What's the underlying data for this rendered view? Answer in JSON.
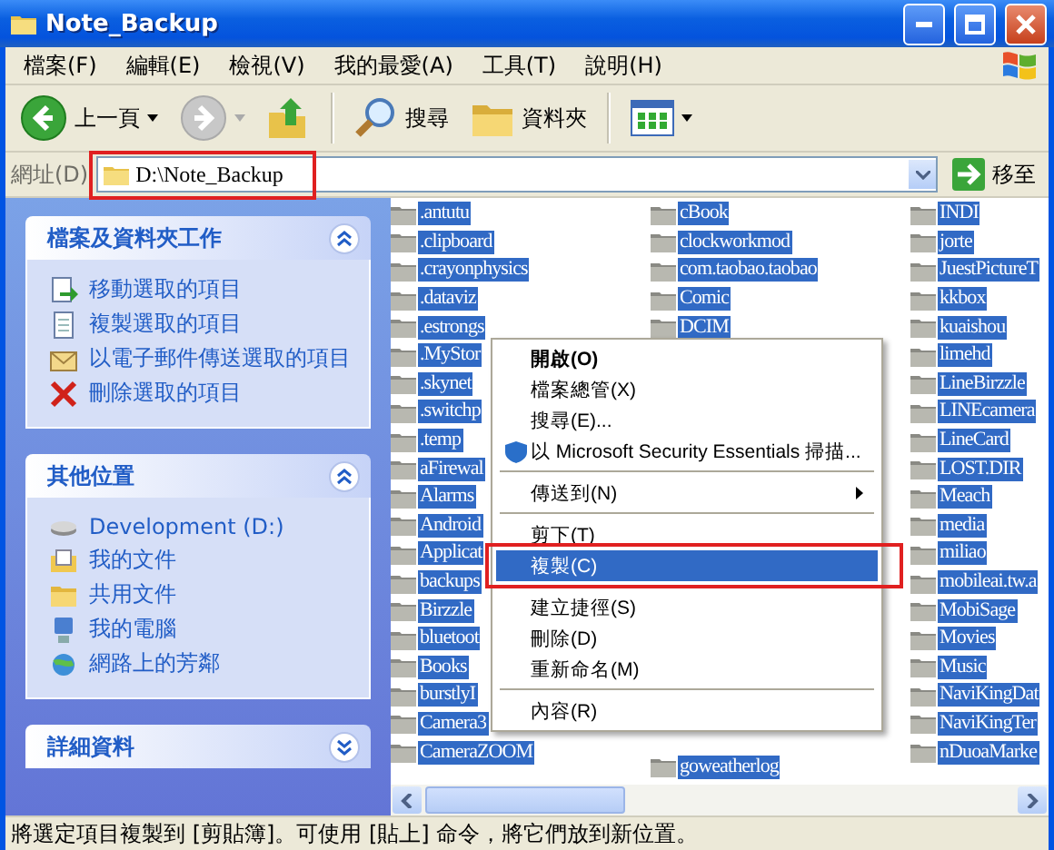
{
  "window": {
    "title": "Note_Backup"
  },
  "menu_bar": [
    "檔案(F)",
    "編輯(E)",
    "檢視(V)",
    "我的最愛(A)",
    "工具(T)",
    "說明(H)"
  ],
  "toolbar": [
    {
      "kind": "back",
      "label": "上一頁",
      "disabled": false
    },
    {
      "kind": "forward",
      "disabled": true
    },
    {
      "kind": "up"
    },
    {
      "kind": "separator"
    },
    {
      "kind": "search",
      "label": "搜尋"
    },
    {
      "kind": "folders",
      "label": "資料夾"
    },
    {
      "kind": "separator"
    },
    {
      "kind": "views"
    }
  ],
  "address": {
    "label": "網址(D)",
    "value": "D:\\Note_Backup",
    "highlighted": true,
    "go_label": "移至"
  },
  "task_panels": [
    {
      "title": "檔案及資料夾工作",
      "expanded": true,
      "items": [
        {
          "label": "移動選取的項目"
        },
        {
          "label": "複製選取的項目"
        },
        {
          "label": "以電子郵件傳送選取的項目"
        },
        {
          "label": "刪除選取的項目"
        }
      ]
    },
    {
      "title": "其他位置",
      "expanded": true,
      "items": [
        {
          "label": "Development (D:)"
        },
        {
          "label": "我的文件"
        },
        {
          "label": "共用文件"
        },
        {
          "label": "我的電腦"
        },
        {
          "label": "網路上的芳鄰"
        }
      ]
    },
    {
      "title": "詳細資料",
      "expanded": false
    }
  ],
  "file_columns": [
    {
      "items": [
        {
          "name": ".antutu",
          "selected": true
        },
        {
          "name": ".clipboard",
          "selected": true
        },
        {
          "name": ".crayonphysics",
          "selected": true
        },
        {
          "name": ".dataviz",
          "selected": true
        },
        {
          "name": ".estrongs",
          "selected": true
        },
        {
          "name": ".MyStor",
          "selected": true
        },
        {
          "name": ".skynet",
          "selected": true
        },
        {
          "name": ".switchp",
          "selected": true
        },
        {
          "name": ".temp",
          "selected": true
        },
        {
          "name": "aFirewal",
          "selected": true
        },
        {
          "name": "Alarms",
          "selected": true
        },
        {
          "name": "Android",
          "selected": true
        },
        {
          "name": "Applicat",
          "selected": true
        },
        {
          "name": "backups",
          "selected": true
        },
        {
          "name": "Birzzle",
          "selected": true
        },
        {
          "name": "bluetoot",
          "selected": true
        },
        {
          "name": "Books",
          "selected": true
        },
        {
          "name": "burstlyI",
          "selected": true
        },
        {
          "name": "Camera3",
          "selected": true
        },
        {
          "name": "CameraZOOM",
          "selected": true
        }
      ]
    },
    {
      "items": [
        {
          "name": "cBook",
          "selected": true
        },
        {
          "name": "clockworkmod",
          "selected": true
        },
        {
          "name": "com.taobao.taobao",
          "selected": true
        },
        {
          "name": "Comic",
          "selected": true
        },
        {
          "name": "DCIM",
          "selected": true
        }
      ],
      "bottom_items": [
        {
          "name": "goweatherlog",
          "selected": true
        }
      ]
    },
    {
      "items": [
        {
          "name": "INDI",
          "selected": true
        },
        {
          "name": "jorte",
          "selected": true
        },
        {
          "name": "JuestPictureT",
          "selected": true
        },
        {
          "name": "kkbox",
          "selected": true
        },
        {
          "name": "kuaishou",
          "selected": true
        },
        {
          "name": "limehd",
          "selected": true
        },
        {
          "name": "LineBirzzle",
          "selected": true
        },
        {
          "name": "LINEcamera",
          "selected": true
        },
        {
          "name": "LineCard",
          "selected": true
        },
        {
          "name": "LOST.DIR",
          "selected": true
        },
        {
          "name": "Meach",
          "selected": true
        },
        {
          "name": "media",
          "selected": true
        },
        {
          "name": "miliao",
          "selected": true
        },
        {
          "name": "mobileai.tw.a",
          "selected": true
        },
        {
          "name": "MobiSage",
          "selected": true
        },
        {
          "name": "Movies",
          "selected": true
        },
        {
          "name": "Music",
          "selected": true
        },
        {
          "name": "NaviKingDat",
          "selected": true
        },
        {
          "name": "NaviKingTer",
          "selected": true
        },
        {
          "name": "nDuoaMarke",
          "selected": true
        }
      ]
    }
  ],
  "context_menu": [
    {
      "kind": "item",
      "label": "開啟(O)",
      "bold": true,
      "selected": false
    },
    {
      "kind": "item",
      "label": "檔案總管(X)",
      "selected": false
    },
    {
      "kind": "item",
      "label": "搜尋(E)...",
      "selected": false
    },
    {
      "kind": "icon_item",
      "label": "以 Microsoft Security Essentials 掃描...",
      "selected": false
    },
    {
      "kind": "separator"
    },
    {
      "kind": "item",
      "label": "傳送到(N)",
      "submenu": true,
      "selected": false
    },
    {
      "kind": "separator"
    },
    {
      "kind": "item",
      "label": "剪下(T)",
      "selected": false
    },
    {
      "kind": "item",
      "label": "複製(C)",
      "selected": true,
      "highlighted": true
    },
    {
      "kind": "separator"
    },
    {
      "kind": "item",
      "label": "建立捷徑(S)",
      "selected": false
    },
    {
      "kind": "item",
      "label": "刪除(D)",
      "selected": false
    },
    {
      "kind": "item",
      "label": "重新命名(M)",
      "selected": false
    },
    {
      "kind": "separator"
    },
    {
      "kind": "item",
      "label": "內容(R)",
      "selected": false
    }
  ],
  "status_bar": "將選定項目複製到 [剪貼簿]。可使用 [貼上] 命令，將它們放到新位置。"
}
